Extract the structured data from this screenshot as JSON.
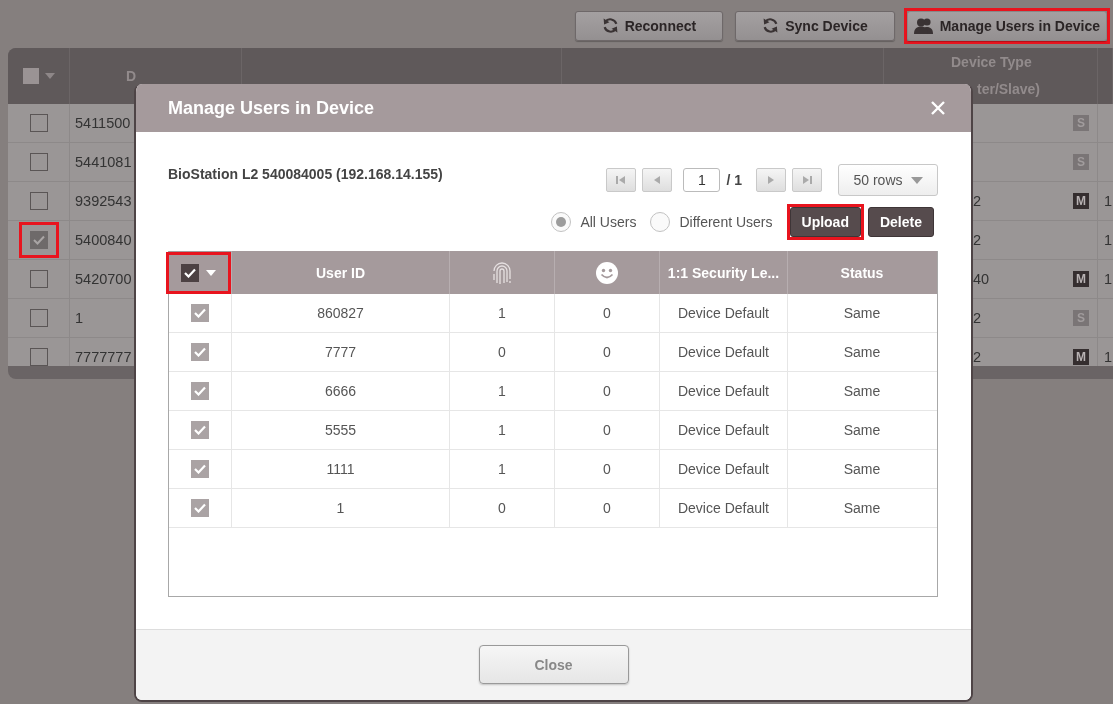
{
  "toolbar": {
    "buttons": [
      {
        "label": "Reconnect",
        "highlighted": false
      },
      {
        "label": "Sync Device",
        "highlighted": false
      },
      {
        "label": "Manage Users in Device",
        "highlighted": true
      }
    ]
  },
  "device_table": {
    "select_all": {
      "checked": false
    },
    "columns": [
      {
        "label": "D"
      },
      {
        "label": "Device Type",
        "label_line_2": "ter/Slave)"
      }
    ],
    "rows": [
      {
        "checked": false,
        "highlighted": false,
        "id": "5411500",
        "badge": {
          "text": "S",
          "kind": "slave"
        }
      },
      {
        "checked": false,
        "highlighted": false,
        "id": "5441081",
        "badge": {
          "text": "S",
          "kind": "slave"
        }
      },
      {
        "checked": false,
        "highlighted": false,
        "id": "9392543",
        "type": "2",
        "badge": {
          "text": "M",
          "kind": "master"
        },
        "column_last": "1"
      },
      {
        "checked": true,
        "highlighted": true,
        "id": "5400840",
        "type": "2",
        "column_last": "1"
      },
      {
        "checked": false,
        "highlighted": false,
        "id": "5420700",
        "type": "40",
        "badge": {
          "text": "M",
          "kind": "master"
        },
        "column_last": "1"
      },
      {
        "checked": false,
        "highlighted": false,
        "id": "1",
        "type": "2",
        "badge": {
          "text": "S",
          "kind": "slave"
        }
      },
      {
        "checked": false,
        "highlighted": false,
        "id": "7777777",
        "type": "2",
        "badge": {
          "text": "M",
          "kind": "master"
        },
        "column_last": "1"
      }
    ]
  },
  "dialog": {
    "title": "Manage Users in Device",
    "device": "BioStation L2 540084005 (192.168.14.155)",
    "pager": {
      "page": "1",
      "total": "/ 1",
      "rows": "50 rows"
    },
    "filters": [
      {
        "label": "All Users",
        "selected": true
      },
      {
        "label": "Different Users",
        "selected": false
      }
    ],
    "actions": [
      {
        "label": "Upload",
        "highlighted": true
      },
      {
        "label": "Delete",
        "highlighted": false
      }
    ],
    "table": {
      "select_all": {
        "checked": true,
        "highlighted": true
      },
      "columns": [
        {
          "kind": "text",
          "label": "User ID"
        },
        {
          "kind": "fingerprint"
        },
        {
          "kind": "face"
        },
        {
          "kind": "text",
          "label": "1:1 Security Le..."
        },
        {
          "kind": "text",
          "label": "Status"
        }
      ],
      "rows": [
        {
          "checked": true,
          "cells": [
            "860827",
            "1",
            "0",
            "Device Default",
            "Same"
          ]
        },
        {
          "checked": true,
          "cells": [
            "7777",
            "0",
            "0",
            "Device Default",
            "Same"
          ]
        },
        {
          "checked": true,
          "cells": [
            "6666",
            "1",
            "0",
            "Device Default",
            "Same"
          ]
        },
        {
          "checked": true,
          "cells": [
            "5555",
            "1",
            "0",
            "Device Default",
            "Same"
          ]
        },
        {
          "checked": true,
          "cells": [
            "1111",
            "1",
            "0",
            "Device Default",
            "Same"
          ]
        },
        {
          "checked": true,
          "cells": [
            "1",
            "0",
            "0",
            "Device Default",
            "Same"
          ]
        }
      ]
    },
    "footer": {
      "button": "Close"
    }
  }
}
